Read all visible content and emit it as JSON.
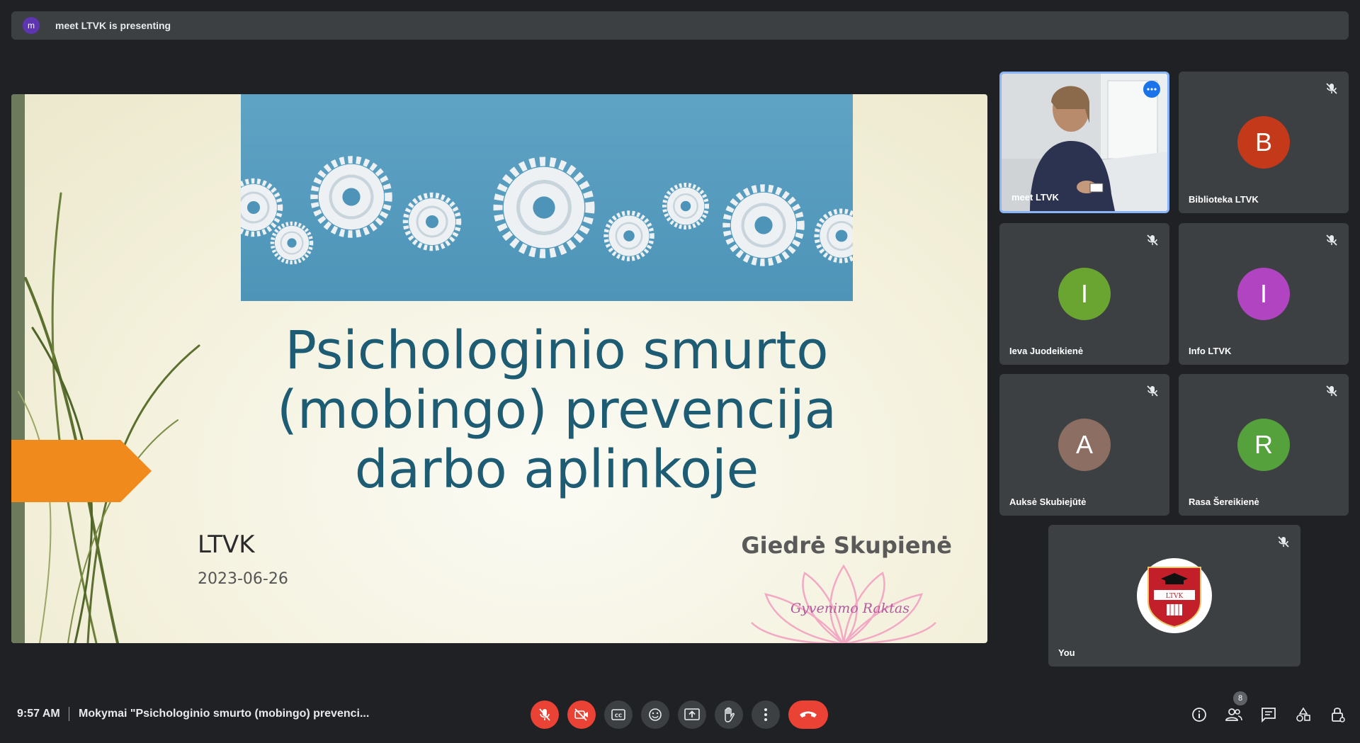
{
  "presenting_bar": {
    "avatar_letter": "m",
    "text": "meet LTVK is presenting"
  },
  "slide": {
    "title_lines": [
      "Psichologinio smurto",
      "(mobingo) prevencija",
      "darbo aplinkoje"
    ],
    "org": "LTVK",
    "date": "2023-06-26",
    "author": "Giedrė Skupienė",
    "logo_text": "Gyvenimo Raktas",
    "colors": {
      "title": "#1d5c73",
      "arrow": "#f18a1c",
      "banner": "#5fa3c4"
    }
  },
  "participants": [
    {
      "name": "meet LTVK",
      "type": "video"
    },
    {
      "name": "Biblioteka LTVK",
      "letter": "B",
      "color": "#c5391b"
    },
    {
      "name": "Ieva Juodeikienė",
      "letter": "I",
      "color": "#6aa532"
    },
    {
      "name": "Info LTVK",
      "letter": "I",
      "color": "#b044c1"
    },
    {
      "name": "Auksė Skubiejūtė",
      "letter": "A",
      "color": "#8d6e63"
    },
    {
      "name": "Rasa Šereikienė",
      "letter": "R",
      "color": "#55a23d"
    },
    {
      "name": "You",
      "type": "logo",
      "logo_text": "LTVK"
    }
  ],
  "bottom_bar": {
    "time": "9:57 AM",
    "meeting_title": "Mokymai \"Psichologinio smurto (mobingo) prevenci...",
    "participant_count": "8",
    "controls": [
      "mic-off-icon",
      "camera-off-icon",
      "captions-icon",
      "emoji-icon",
      "present-icon",
      "raise-hand-icon",
      "more-options-icon",
      "end-call-icon"
    ],
    "right_controls": [
      "info-icon",
      "people-icon",
      "chat-icon",
      "activities-icon",
      "host-controls-icon"
    ]
  }
}
